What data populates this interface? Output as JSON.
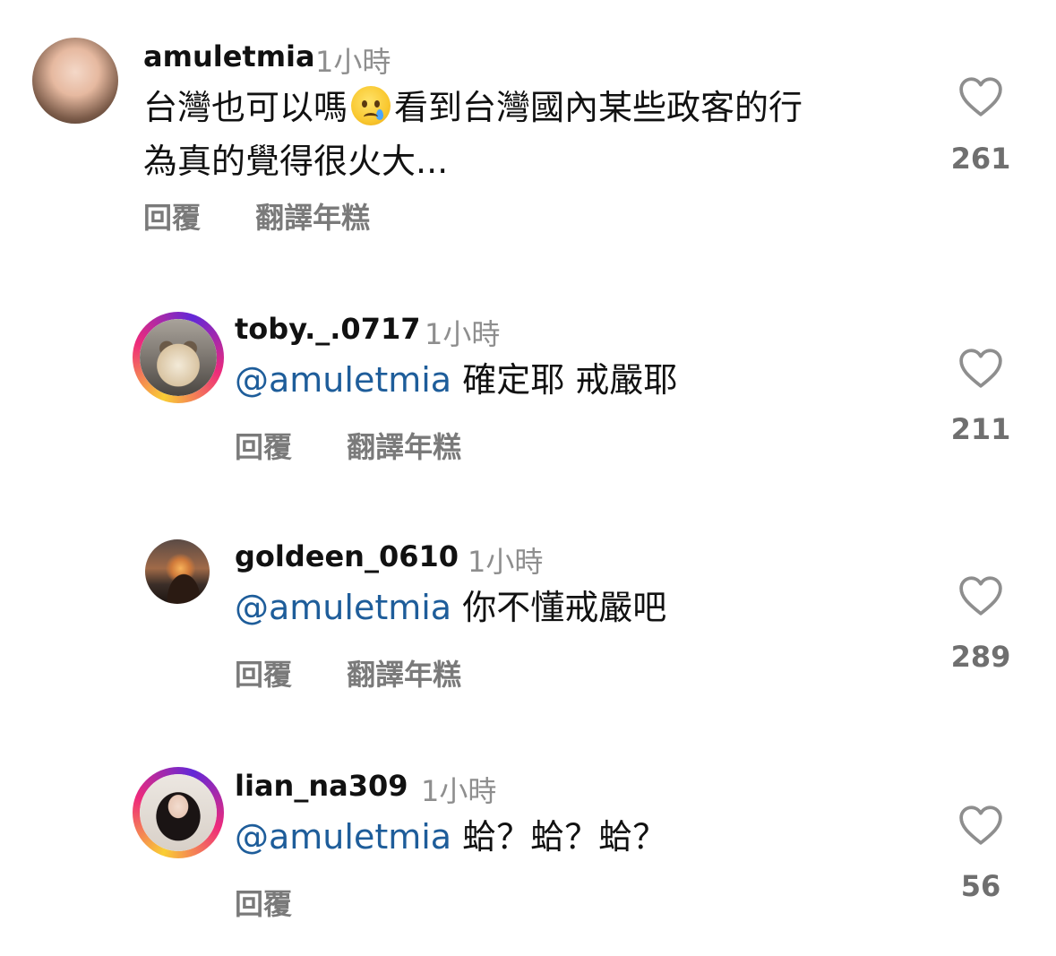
{
  "comments": [
    {
      "username": "amuletmia",
      "time": "1小時",
      "text_before_emoji": "台灣也可以嗎",
      "emoji": "crying-face-emoji",
      "text_after_emoji": "看到台灣國內某些政客的行",
      "text_line2": "為真的覺得很火大...",
      "reply_label": "回覆",
      "translate_label": "翻譯年糕",
      "likes": "261",
      "avatar": "woman-portrait"
    },
    {
      "username": "toby._.0717",
      "time": "1小時",
      "mention": "@amuletmia",
      "text": "確定耶 戒嚴耶",
      "reply_label": "回覆",
      "translate_label": "翻譯年糕",
      "likes": "211",
      "avatar": "bulldog-photo"
    },
    {
      "username": "goldeen_0610",
      "time": "1小時",
      "mention": "@amuletmia",
      "text": "你不懂戒嚴吧",
      "reply_label": "回覆",
      "translate_label": "翻譯年糕",
      "likes": "289",
      "avatar": "sunset-silhouette"
    },
    {
      "username": "lian_na309",
      "time": "1小時",
      "mention": "@amuletmia",
      "text": "蛤？蛤？蛤？",
      "reply_label": "回覆",
      "likes": "56",
      "avatar": "woman-long-hair"
    }
  ],
  "colors": {
    "mention": "#1e5d9a",
    "muted": "#8e8e8e",
    "story_ring_start": "#f9ce34",
    "story_ring_mid": "#ee2a7b",
    "story_ring_end": "#6228d7"
  }
}
